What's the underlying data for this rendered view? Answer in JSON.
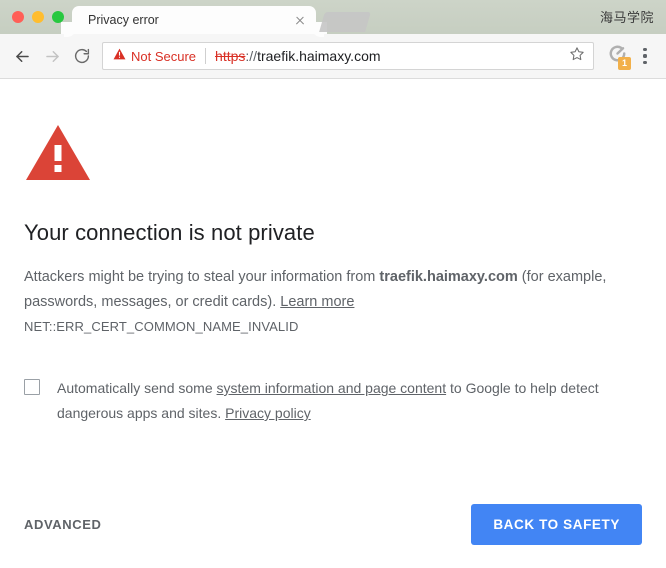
{
  "window": {
    "traffic_lights": [
      "close",
      "minimize",
      "maximize"
    ],
    "brand_label": "海马学院"
  },
  "tabs": [
    {
      "title": "Privacy error",
      "active": true,
      "close_label": "×"
    }
  ],
  "toolbar": {
    "back_icon": "back-arrow-icon",
    "forward_icon": "forward-arrow-icon",
    "reload_icon": "reload-icon",
    "security_label": "Not Secure",
    "security_icon": "warning-triangle-icon",
    "url_scheme": "https",
    "url_separator": "://",
    "url_host": "traefik.haimaxy.com",
    "bookmark_icon": "star-icon",
    "extension_icon": "extension-icon",
    "extension_badge": "1",
    "menu_icon": "three-dot-menu-icon"
  },
  "interstitial": {
    "icon": "warning-triangle-icon",
    "heading": "Your connection is not private",
    "body_prefix": "Attackers might be trying to steal your information from ",
    "body_host": "traefik.haimaxy.com",
    "body_suffix": " (for example, passwords, messages, or credit cards). ",
    "learn_more": "Learn more",
    "error_code": "NET::ERR_CERT_COMMON_NAME_INVALID",
    "optin_prefix": "Automatically send some ",
    "optin_link_1": "system information and page content",
    "optin_middle": " to Google to help detect dangerous apps and sites. ",
    "optin_link_2": "Privacy policy",
    "checkbox_checked": false,
    "advanced_label": "ADVANCED",
    "safety_label": "BACK TO SAFETY"
  },
  "colors": {
    "error_red": "#d93025",
    "warning_triangle": "#db4437",
    "primary_blue": "#4285f4",
    "badge_orange": "#f2b04a",
    "tabstrip": "#c8d0c3",
    "toolbar": "#f6f6f6"
  }
}
